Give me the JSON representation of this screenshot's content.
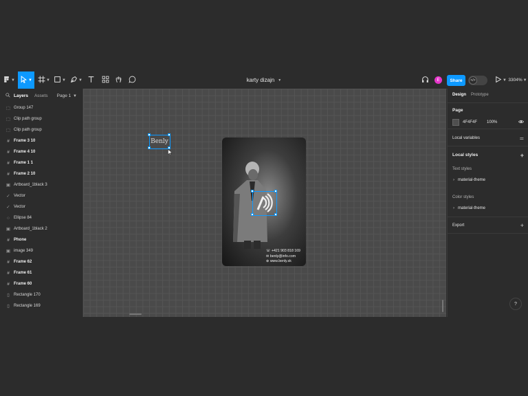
{
  "toolbar": {
    "file_title": "karty dizajn",
    "share_label": "Share",
    "user_initial": "E",
    "zoom": "3304%"
  },
  "left_panel": {
    "tabs": [
      "Layers",
      "Assets"
    ],
    "page_selector": "Page 1",
    "layers": [
      {
        "name": "Group 147",
        "icon": "group-icon",
        "bold": false
      },
      {
        "name": "Clip path group",
        "icon": "group-icon",
        "bold": false
      },
      {
        "name": "Clip path group",
        "icon": "group-icon",
        "bold": false
      },
      {
        "name": "Frame 3 10",
        "icon": "frame-icon",
        "bold": true
      },
      {
        "name": "Frame 4 10",
        "icon": "frame-icon",
        "bold": true
      },
      {
        "name": "Frame 1 1",
        "icon": "frame-icon",
        "bold": true
      },
      {
        "name": "Frame 2 10",
        "icon": "frame-icon",
        "bold": true
      },
      {
        "name": "Artboard_1black 3",
        "icon": "image-icon",
        "bold": false
      },
      {
        "name": "Vector",
        "icon": "vector-icon",
        "bold": false
      },
      {
        "name": "Vector",
        "icon": "vector-icon",
        "bold": false
      },
      {
        "name": "Ellipse 84",
        "icon": "ellipse-icon",
        "bold": false
      },
      {
        "name": "Artboard_1black 2",
        "icon": "image-icon",
        "bold": false
      },
      {
        "name": "Phone",
        "icon": "frame-icon",
        "bold": true
      },
      {
        "name": "image 349",
        "icon": "image-icon",
        "bold": false
      },
      {
        "name": "Frame 62",
        "icon": "frame-icon",
        "bold": true
      },
      {
        "name": "Frame 61",
        "icon": "frame-icon",
        "bold": true
      },
      {
        "name": "Frame 60",
        "icon": "frame-icon",
        "bold": true
      },
      {
        "name": "Rectangle 170",
        "icon": "rectangle-icon",
        "bold": false
      },
      {
        "name": "Rectangle 169",
        "icon": "rectangle-icon",
        "bold": false
      }
    ]
  },
  "canvas": {
    "logo_text": "Benly",
    "card": {
      "phone": "+421 903 818 169",
      "email": "benly@info.com",
      "website": "www.benly.sk"
    }
  },
  "right_panel": {
    "tabs": [
      "Design",
      "Prototype"
    ],
    "page_section": "Page",
    "page_color": "4F4F4F",
    "page_opacity": "100%",
    "local_variables": "Local variables",
    "local_styles": "Local styles",
    "text_styles": "Text styles",
    "text_style_item": "material-theme",
    "color_styles": "Color styles",
    "color_style_item": "material-theme",
    "export": "Export"
  },
  "help_label": "?",
  "colors": {
    "accent": "#0d99ff",
    "avatar": "#e535c9",
    "canvas": "#4a4a4a",
    "page_swatch": "#4f4f4f"
  }
}
